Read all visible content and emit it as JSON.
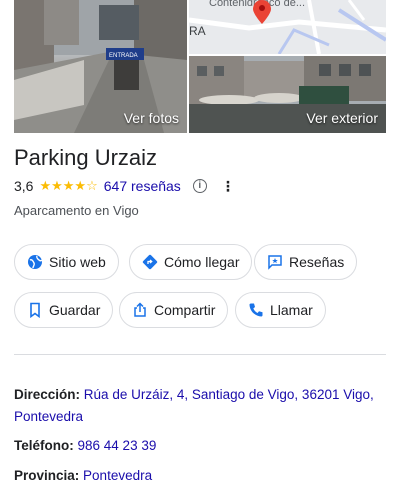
{
  "photos": {
    "left_label": "Ver fotos",
    "right_label": "Ver exterior",
    "map_text_top": "Contenidranco de...",
    "map_text_side": "RA",
    "sign_text": "ENTRADA"
  },
  "place": {
    "name": "Parking Urzaiz",
    "rating": "3,6",
    "stars": "★★★★☆",
    "reviews": "647 reseñas",
    "info_icon": "i",
    "more_icon": "⋮",
    "category": "Aparcamento en Vigo"
  },
  "actions": [
    {
      "label": "Sitio web",
      "icon": "globe-icon"
    },
    {
      "label": "Cómo llegar",
      "icon": "directions-icon"
    },
    {
      "label": "Reseñas",
      "icon": "review-icon"
    },
    {
      "label": "Guardar",
      "icon": "bookmark-icon"
    },
    {
      "label": "Compartir",
      "icon": "share-icon"
    },
    {
      "label": "Llamar",
      "icon": "phone-icon"
    }
  ],
  "details": {
    "address_label": "Dirección:",
    "address_value": "Rúa de Urzáiz, 4, Santiago de Vigo, 36201 Vigo, Pontevedra",
    "phone_label": "Teléfono:",
    "phone_value": "986 44 23 39",
    "province_label": "Provincia:",
    "province_value": "Pontevedra"
  },
  "colors": {
    "accent_blue": "#1a73e8",
    "link": "#1a0dab",
    "star": "#fbbc04",
    "map_pin": "#ea4335"
  }
}
